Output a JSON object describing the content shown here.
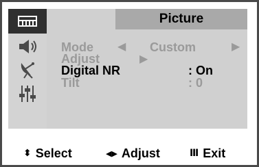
{
  "menu": {
    "title": "Picture",
    "sidebar": [
      {
        "icon": "input-icon",
        "active": true
      },
      {
        "icon": "speaker-icon",
        "active": false
      },
      {
        "icon": "satellite-dish-icon",
        "active": false
      },
      {
        "icon": "sliders-icon",
        "active": false
      }
    ],
    "rows": [
      {
        "label": "Mode",
        "value": "Custom",
        "left_arrow": "◀",
        "right_arrow": "▶",
        "highlighted": false
      },
      {
        "label": "Adjust",
        "arrow": "▶",
        "highlighted": false
      },
      {
        "label": "Digital NR",
        "value": ": On",
        "highlighted": true
      },
      {
        "label": "Tilt",
        "value": ": 0",
        "highlighted": false
      }
    ]
  },
  "footer": {
    "select_symbol": "⬍",
    "select_label": "Select",
    "adjust_symbol": "◀▶",
    "adjust_label": "Adjust",
    "exit_symbol": "Ⅲ",
    "exit_label": "Exit"
  },
  "colors": {
    "panel": "#d0d0d0",
    "title_bar": "#a9a9a9",
    "sidebar_active": "#2f2f2f",
    "text_dim": "#9a9a9a",
    "text_highlight": "#000000"
  }
}
